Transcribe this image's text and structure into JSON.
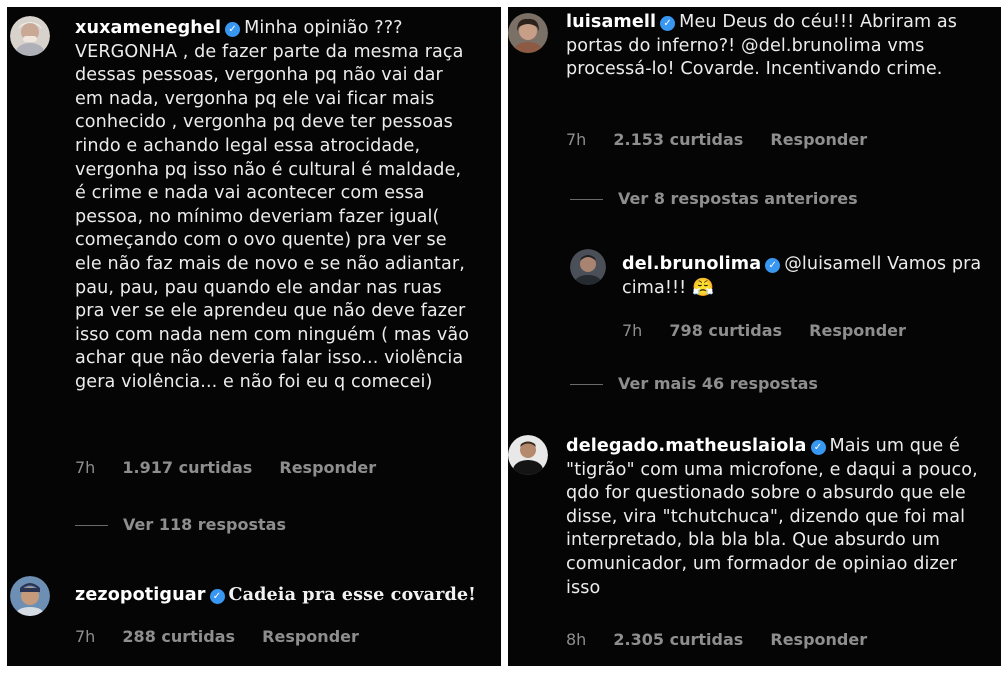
{
  "left": {
    "comments": [
      {
        "username": "xuxameneghel",
        "text": "Minha opinião ??? VERGONHA , de fazer parte da mesma raça dessas pessoas, vergonha pq não vai dar em nada, vergonha pq ele vai ficar mais conhecido , vergonha pq deve ter pessoas rindo e achando legal essa atrocidade, vergonha pq isso não é cultural é maldade, é crime e nada vai acontecer com essa pessoa, no mínimo deveriam fazer igual( começando com o ovo quente) pra ver se ele não faz mais de novo e se não adiantar, pau, pau, pau quando ele andar nas ruas pra ver se ele aprendeu que não deve fazer isso com nada nem com ninguém ( mas vão achar que não deveria falar isso... violência gera violência... e não foi eu q comecei)",
        "time": "7h",
        "likes": "1.917 curtidas",
        "reply": "Responder"
      },
      {
        "username": "zezopotiguar",
        "text": "Cadeia pra esse covarde!",
        "time": "7h",
        "likes": "288 curtidas",
        "reply": "Responder"
      }
    ],
    "thread_label": "Ver 118 respostas"
  },
  "right": {
    "comments": [
      {
        "username": "luisamell",
        "text": "Meu Deus do céu!!! Abriram as portas do inferno?! @del.brunolima vms processá-lo! Covarde. Incentivando crime.",
        "time": "7h",
        "likes": "2.153 curtidas",
        "reply": "Responder"
      },
      {
        "username": "del.brunolima",
        "text": "@luisamell Vamos pra cima!!! 😤",
        "time": "7h",
        "likes": "798 curtidas",
        "reply": "Responder"
      },
      {
        "username": "delegado.matheuslaiola",
        "text": "Mais um que é \"tigrão\" com uma microfone, e daqui a pouco, qdo for questionado sobre o absurdo que ele disse, vira \"tchutchuca\", dizendo que foi mal interpretado, bla bla bla. Que absurdo um comunicador, um formador de opiniao dizer isso",
        "time": "8h",
        "likes": "2.305 curtidas",
        "reply": "Responder"
      }
    ],
    "thread_prev": "Ver 8 respostas anteriores",
    "thread_more": "Ver mais 46 respostas"
  },
  "icons": {
    "verified": "verified-badge-icon",
    "verified_color": "#3897f0"
  },
  "colors": {
    "background": "#050505",
    "meta_text": "#8e8e8e"
  }
}
